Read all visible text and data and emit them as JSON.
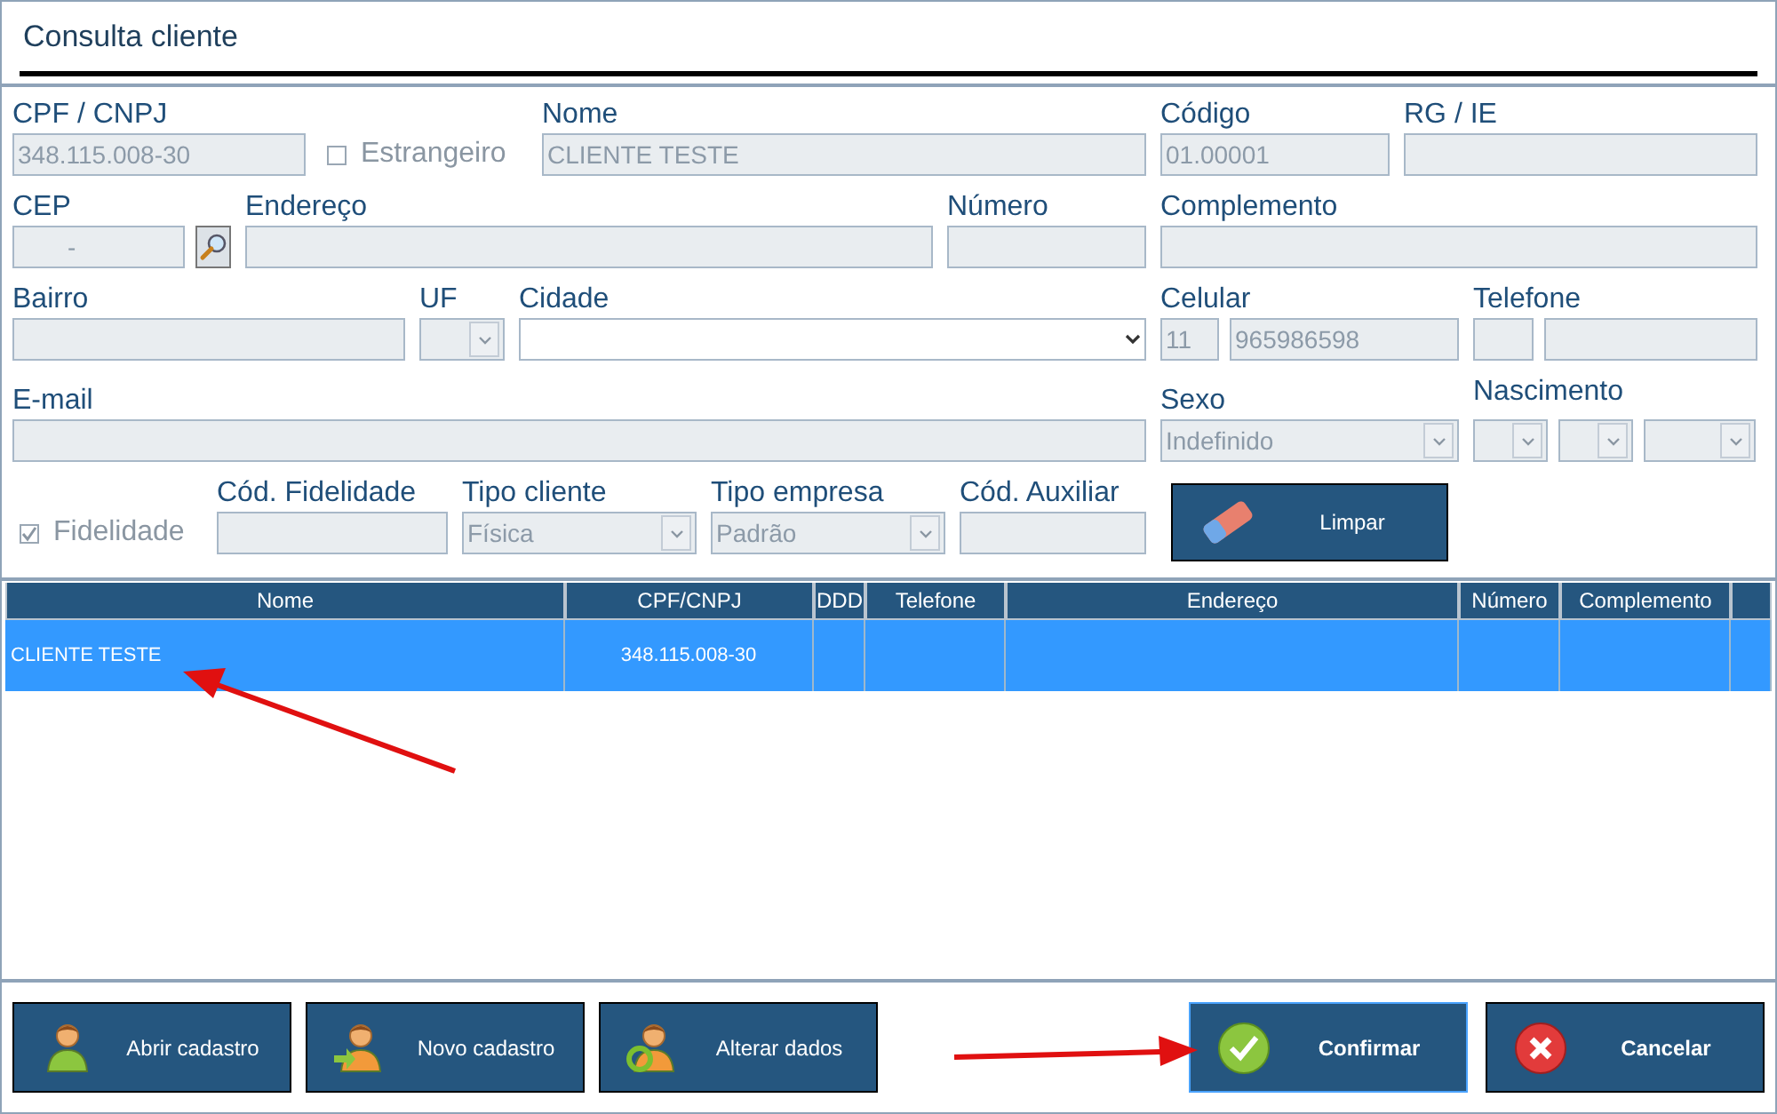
{
  "title": "Consulta cliente",
  "form_rows": [
    [
      {
        "kind": "field",
        "label": "CPF / CNPJ",
        "inputs": [
          {
            "kind": "text",
            "value": "348.115.008-30",
            "disabled": true
          }
        ]
      },
      {
        "kind": "checkbox",
        "label": "Estrangeiro",
        "checked": false,
        "disabled": true
      },
      {
        "kind": "field",
        "label": "Nome",
        "inputs": [
          {
            "kind": "text",
            "value": "CLIENTE TESTE",
            "disabled": true
          }
        ]
      },
      {
        "kind": "field",
        "label": "Código",
        "inputs": [
          {
            "kind": "text",
            "value": "01.00001",
            "disabled": true
          }
        ]
      },
      {
        "kind": "field",
        "label": "RG / IE",
        "inputs": [
          {
            "kind": "text",
            "disabled": true
          }
        ]
      }
    ],
    [
      {
        "kind": "field",
        "label": "CEP",
        "inputs": [
          {
            "kind": "text",
            "value": "-",
            "disabled": true
          },
          {
            "kind": "search"
          }
        ]
      },
      {
        "kind": "field",
        "label": "Endereço",
        "inputs": [
          {
            "kind": "text",
            "disabled": true
          }
        ]
      },
      {
        "kind": "field",
        "label": "Número",
        "inputs": [
          {
            "kind": "text",
            "disabled": true
          }
        ]
      },
      {
        "kind": "field",
        "label": "Complemento",
        "inputs": [
          {
            "kind": "text",
            "disabled": true
          }
        ]
      }
    ],
    [
      {
        "kind": "field",
        "label": "Bairro",
        "inputs": [
          {
            "kind": "text",
            "disabled": true
          }
        ]
      },
      {
        "kind": "field",
        "label": "UF",
        "inputs": [
          {
            "kind": "select",
            "disabled": true
          }
        ]
      },
      {
        "kind": "field",
        "label": "Cidade",
        "inputs": [
          {
            "kind": "select",
            "disabled": false
          }
        ]
      },
      {
        "kind": "field",
        "label": "Celular",
        "inputs": [
          {
            "kind": "text",
            "value": "11",
            "disabled": true
          },
          {
            "kind": "text",
            "value": "965986598",
            "disabled": true
          }
        ]
      },
      {
        "kind": "field",
        "label": "Telefone",
        "inputs": [
          {
            "kind": "text",
            "disabled": true
          },
          {
            "kind": "text",
            "disabled": true
          }
        ]
      }
    ],
    [
      {
        "kind": "field",
        "label": "E-mail",
        "inputs": [
          {
            "kind": "text",
            "disabled": true
          }
        ]
      },
      {
        "kind": "field",
        "label": "Sexo",
        "inputs": [
          {
            "kind": "select",
            "value": "Indefinido",
            "disabled": true
          }
        ]
      },
      {
        "kind": "field",
        "label": "Nascimento",
        "inputs": [
          {
            "kind": "select",
            "disabled": true
          },
          {
            "kind": "select",
            "disabled": true
          },
          {
            "kind": "select",
            "disabled": true
          }
        ]
      }
    ],
    [
      {
        "kind": "checkbox",
        "label": "Fidelidade",
        "checked": true,
        "disabled": true
      },
      {
        "kind": "field",
        "label": "Cód. Fidelidade",
        "inputs": [
          {
            "kind": "text",
            "disabled": true
          }
        ]
      },
      {
        "kind": "field",
        "label": "Tipo cliente",
        "inputs": [
          {
            "kind": "select",
            "value": "Física",
            "disabled": true
          }
        ]
      },
      {
        "kind": "field",
        "label": "Tipo empresa",
        "inputs": [
          {
            "kind": "select",
            "value": "Padrão",
            "disabled": true
          }
        ]
      },
      {
        "kind": "field",
        "label": "Cód. Auxiliar",
        "inputs": [
          {
            "kind": "text",
            "disabled": true
          }
        ]
      },
      {
        "kind": "button",
        "label": "Limpar"
      }
    ]
  ],
  "table": {
    "columns": [
      "Nome",
      "CPF/CNPJ",
      "DDD",
      "Telefone",
      "Endereço",
      "Número",
      "Complemento"
    ],
    "rows": [
      {
        "cells": [
          "CLIENTE TESTE",
          "348.115.008-30"
        ],
        "selected": true
      }
    ]
  },
  "buttons": [
    {
      "kind": "open",
      "label": "Abrir cadastro",
      "focused": false
    },
    {
      "kind": "new",
      "label": "Novo cadastro",
      "focused": false
    },
    {
      "kind": "edit",
      "label": "Alterar dados",
      "focused": false
    },
    {
      "kind": "confirm",
      "label": "Confirmar",
      "focused": true
    },
    {
      "kind": "cancel",
      "label": "Cancelar",
      "focused": false
    }
  ]
}
